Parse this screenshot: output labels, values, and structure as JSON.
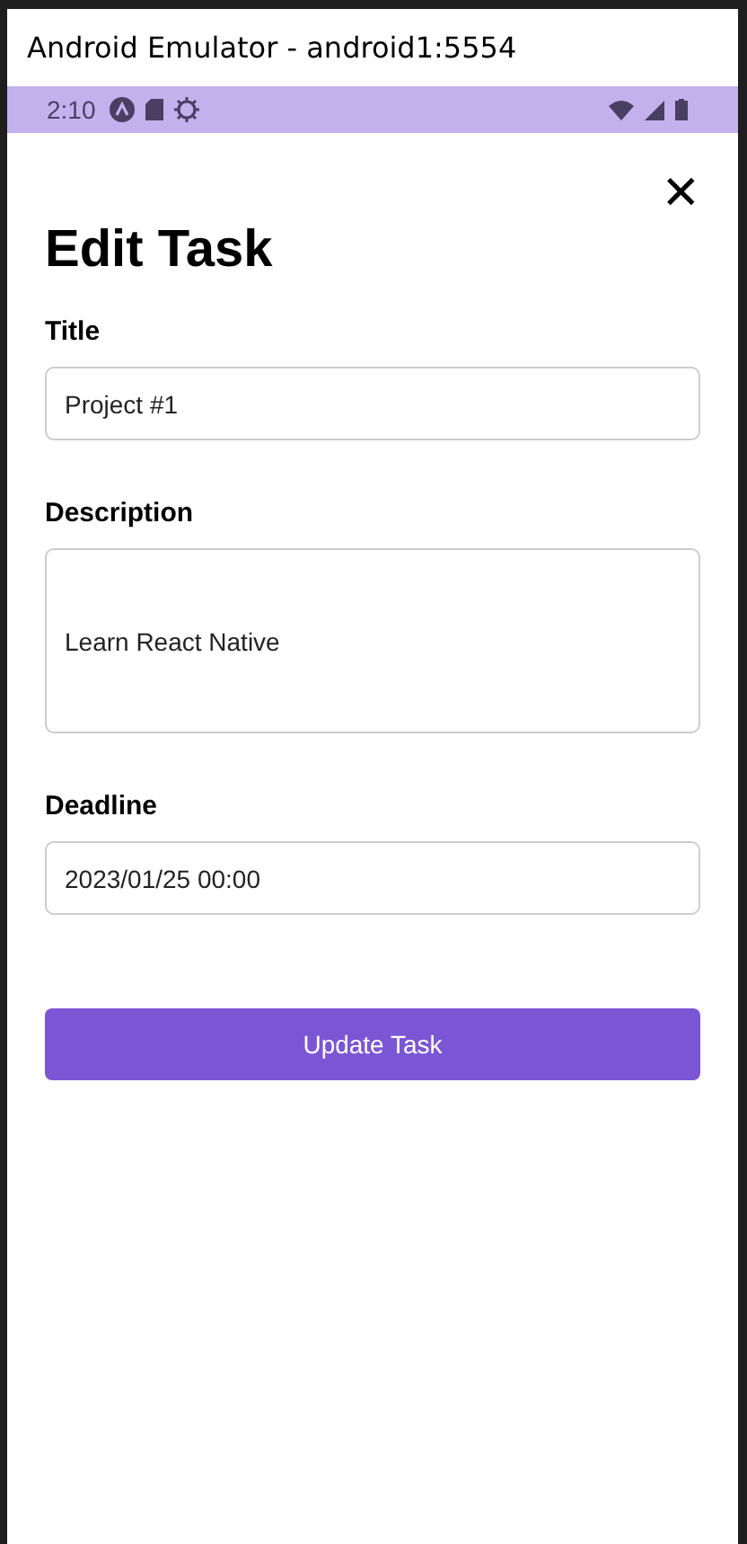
{
  "window": {
    "title": "Android Emulator - android1:5554"
  },
  "status_bar": {
    "time": "2:10"
  },
  "dialog": {
    "title": "Edit Task",
    "close_icon": "✕"
  },
  "fields": [
    {
      "label": "Title",
      "value": "Project #1",
      "kind": "input"
    },
    {
      "label": "Description",
      "value": "Learn React Native",
      "kind": "textarea"
    },
    {
      "label": "Deadline",
      "value": "2023/01/25 00:00",
      "kind": "input"
    }
  ],
  "submit_button": "Update Task"
}
